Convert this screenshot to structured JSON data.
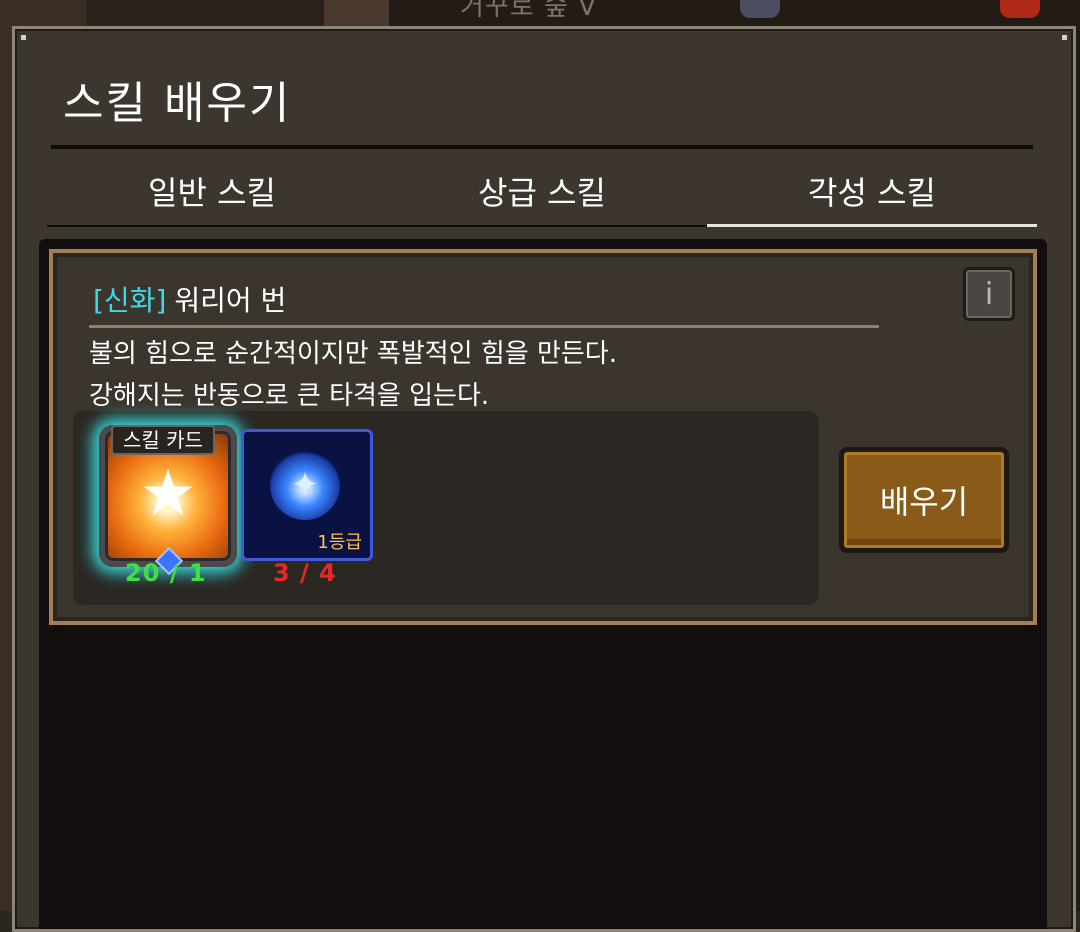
{
  "background": {
    "caption": "거꾸로 숲 V"
  },
  "window": {
    "title": "스킬 배우기"
  },
  "tabs": [
    {
      "label": "일반 스킬",
      "active": false
    },
    {
      "label": "상급 스킬",
      "active": false
    },
    {
      "label": "각성 스킬",
      "active": true
    }
  ],
  "skill": {
    "rarity": "[신화]",
    "name": "워리어 번",
    "description_line1": "불의 힘으로 순간적이지만 폭발적인 힘을 만든다.",
    "description_line2": "강해지는 반동으로 큰 타격을 입는다.",
    "info_label": "i",
    "requirements": [
      {
        "label": "스킬 카드",
        "count": "20 / 1",
        "count_color": "#40e040",
        "icon": "star-burst-icon"
      },
      {
        "label": "1등급",
        "count": "3 / 4",
        "count_color": "#e82828",
        "icon": "blue-crystal-icon"
      }
    ],
    "learn_button": "배우기"
  },
  "colors": {
    "rarity": "#3fd8e8",
    "button": "#8a5a18",
    "card_border": "#a57d59"
  }
}
